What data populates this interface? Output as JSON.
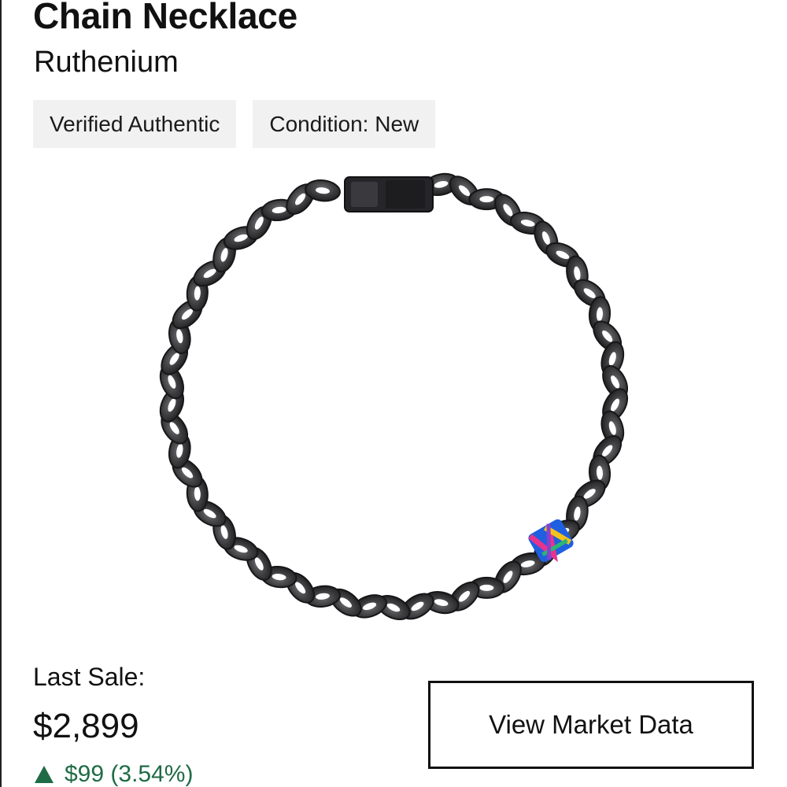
{
  "product": {
    "title": "Chain Necklace",
    "subtitle": "Ruthenium"
  },
  "badges": [
    {
      "label": "Verified Authentic"
    },
    {
      "label": "Condition: New"
    }
  ],
  "sale": {
    "label": "Last Sale:",
    "price": "$2,899",
    "change": "$99 (3.54%)",
    "change_direction": "up",
    "change_color": "#1f6b45"
  },
  "actions": {
    "market_button_label": "View Market Data"
  },
  "image": {
    "subject": "dark ruthenium curb-link chain necklace with multicolor monogram link",
    "chain_color": "#3b3b3d",
    "accent_colors": [
      "#1f5fe0",
      "#e8328c",
      "#f3c21a",
      "#2bb673",
      "#8a3fd1"
    ]
  }
}
